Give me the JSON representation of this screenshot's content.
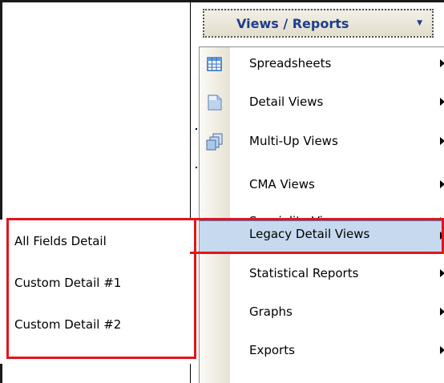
{
  "toolbar": {
    "views_reports_label": "Views / Reports",
    "dropdown_glyph": "▼"
  },
  "menu": {
    "items": [
      {
        "label": "Spreadsheets",
        "icon": "spreadsheet-icon"
      },
      {
        "label": "Detail Views",
        "icon": "document-icon"
      },
      {
        "label": "Multi-Up Views",
        "icon": "multi-document-icon"
      },
      {
        "label": "CMA Views"
      },
      {
        "label": "Speciality Views"
      },
      {
        "label": "Legacy Detail Views",
        "highlighted": true
      },
      {
        "label": "Statistical Reports"
      },
      {
        "label": "Graphs"
      },
      {
        "label": "Exports"
      }
    ]
  },
  "submenu": {
    "items": [
      {
        "label": "All Fields Detail"
      },
      {
        "label": "Custom Detail #1"
      },
      {
        "label": "Custom Detail #2"
      }
    ]
  },
  "colors": {
    "highlight_border": "#e3141c",
    "menu_highlight": "#c6d9ee",
    "button_text": "#1c3f8c"
  }
}
